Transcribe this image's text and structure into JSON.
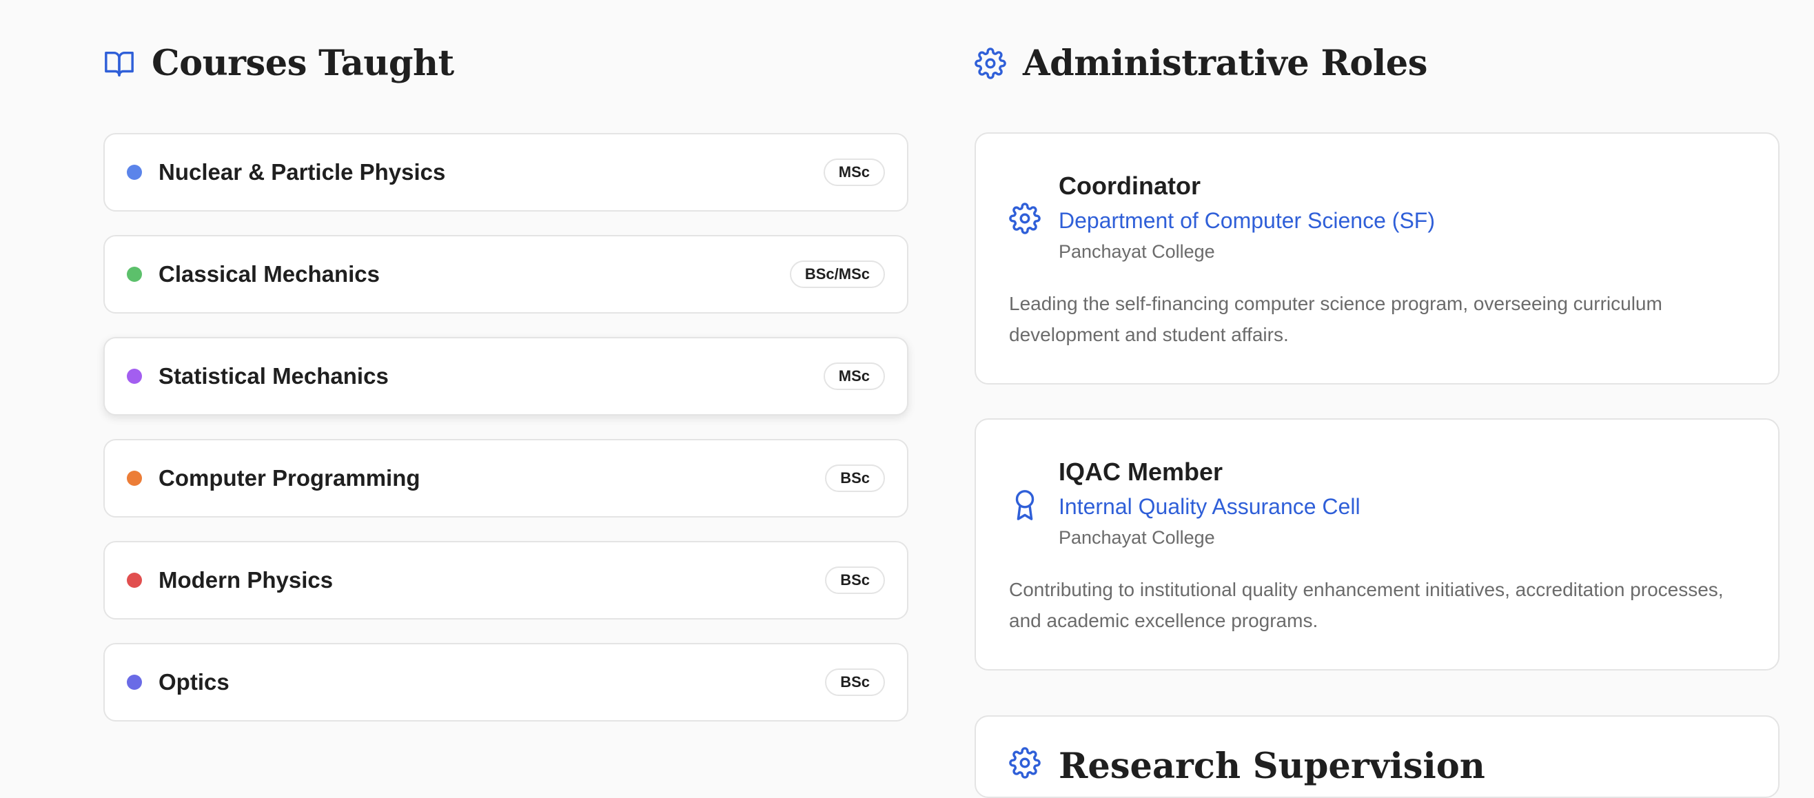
{
  "courses_section": {
    "title": "Courses Taught",
    "icon": "book-open-icon",
    "items": [
      {
        "name": "Nuclear & Particle Physics",
        "level": "MSc",
        "dot_color": "#5b84ea"
      },
      {
        "name": "Classical Mechanics",
        "level": "BSc/MSc",
        "dot_color": "#5cc06b"
      },
      {
        "name": "Statistical Mechanics",
        "level": "MSc",
        "dot_color": "#a35ef0"
      },
      {
        "name": "Computer Programming",
        "level": "BSc",
        "dot_color": "#ec7d37"
      },
      {
        "name": "Modern Physics",
        "level": "BSc",
        "dot_color": "#e14f4f"
      },
      {
        "name": "Optics",
        "level": "BSc",
        "dot_color": "#6a6be6"
      }
    ]
  },
  "admin_section": {
    "title": "Administrative Roles",
    "icon": "gear-icon",
    "accent_color": "#2f5fd8",
    "roles": [
      {
        "title": "Coordinator",
        "department": "Department of Computer Science (SF)",
        "organization": "Panchayat College",
        "description": "Leading the self-financing computer science program, overseeing curriculum development and student affairs.",
        "icon": "gear-icon"
      },
      {
        "title": "IQAC Member",
        "department": "Internal Quality Assurance Cell",
        "organization": "Panchayat College",
        "description": "Contributing to institutional quality enhancement initiatives, accreditation processes, and academic excellence programs.",
        "icon": "award-ribbon-icon"
      },
      {
        "title": "Research Supervision",
        "icon": "gear-icon"
      }
    ]
  }
}
